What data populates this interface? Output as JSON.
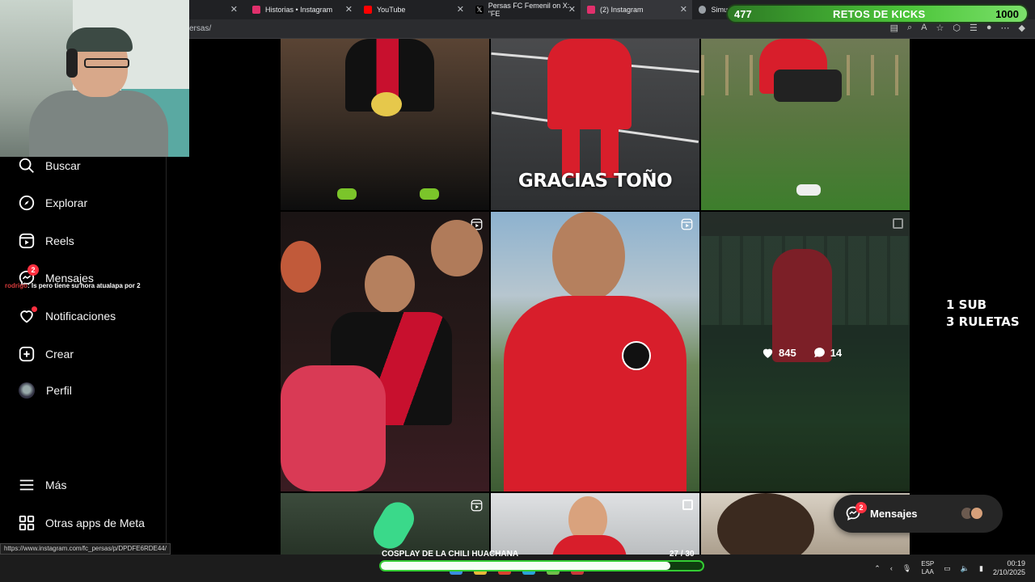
{
  "browser": {
    "tabs": [
      {
        "title": "Historias • Instagram",
        "color": "#e1306c"
      },
      {
        "title": "YouTube",
        "color": "#ff0000"
      },
      {
        "title": "Persas FC Femenil on X: \"FE",
        "color": "#ffffff"
      },
      {
        "title": "(2) Instagram",
        "color": "#e1306c"
      },
      {
        "title": "Simu",
        "color": "#9aa0a6"
      }
    ],
    "url_fragment": "ersas/"
  },
  "retos": {
    "left_value": "477",
    "title": "RETOS DE KICKS",
    "right_value": "1000"
  },
  "nav": {
    "buscar": "Buscar",
    "explorar": "Explorar",
    "reels": "Reels",
    "mensajes": "Mensajes",
    "mensajes_badge": "2",
    "notificaciones": "Notificaciones",
    "crear": "Crear",
    "perfil": "Perfil",
    "mas": "Más",
    "otras": "Otras apps de Meta"
  },
  "chat": {
    "user": "rodrigo",
    "message": ": Is pero tiene su hora atualapa por 2"
  },
  "grid": {
    "tile2_caption": "GRACIAS TOÑO",
    "tile6_likes": "845",
    "tile6_comments": "14"
  },
  "overlay": {
    "line1": "1 SUB",
    "line2": "3 RULETAS"
  },
  "messages_pill": {
    "label": "Mensajes",
    "badge": "2"
  },
  "status_url": "https://www.instagram.com/fc_persas/p/DPDFE6RDE44/",
  "progress": {
    "title": "COSPLAY DE LA CHILI HUACHANA",
    "count": "27  / 30",
    "fraction": 0.9
  },
  "taskbar": {
    "lang_top": "ESP",
    "lang_bottom": "LAA",
    "time": "00:19",
    "date": "2/10/2025"
  }
}
